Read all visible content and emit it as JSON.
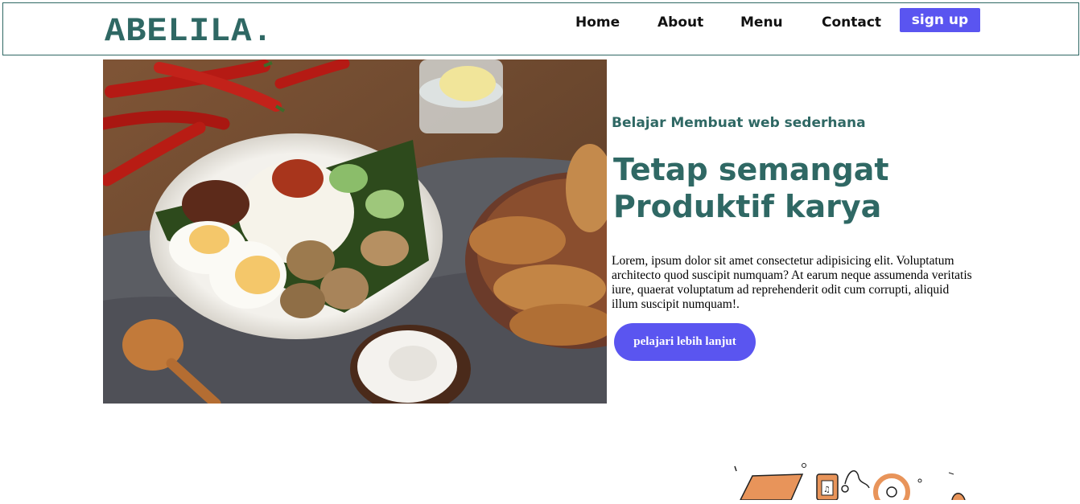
{
  "brand": {
    "logo": "ABELILA."
  },
  "nav": {
    "links": [
      {
        "label": "Home"
      },
      {
        "label": "About"
      },
      {
        "label": "Menu"
      },
      {
        "label": "Contact"
      }
    ],
    "signup_label": "sign up"
  },
  "hero": {
    "image_icon": "food-photo",
    "tagline": "Belajar Membuat web sederhana",
    "headline_line1": "Tetap semangat",
    "headline_line2": "Produktif karya",
    "body": "Lorem, ipsum dolor sit amet consectetur adipisicing elit. Voluptatum architecto quod suscipit numquam? At earum neque assumenda veritatis iure, quaerat voluptatum ad reprehenderit odit cum corrupti, aliquid illum suscipit numquam!.",
    "cta_label": "pelajari lebih lanjut"
  },
  "illustration": {
    "icon": "education-doodles-illustration"
  },
  "colors": {
    "brand": "#2f6864",
    "accent": "#5a55f0",
    "text": "#111111",
    "background": "#ffffff"
  }
}
